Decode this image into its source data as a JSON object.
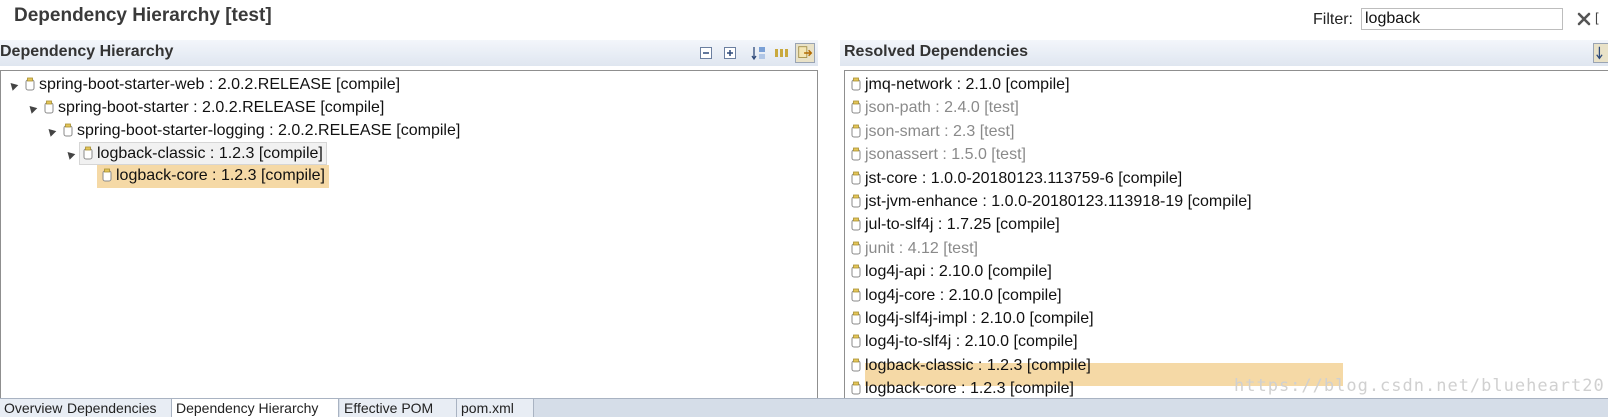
{
  "editor": {
    "title": "Dependency Hierarchy [test]",
    "filter_label": "Filter:",
    "filter_value": "logback"
  },
  "left_panel": {
    "title": "Dependency Hierarchy",
    "tools": [
      "collapse-all-icon",
      "expand-all-icon",
      "sort-alphabetically-icon",
      "show-groupid-icon",
      "link-with-selection-icon"
    ],
    "tree": [
      {
        "text": "spring-boot-starter-web : 2.0.2.RELEASE [compile]",
        "level": 0,
        "expanded": true
      },
      {
        "text": "spring-boot-starter : 2.0.2.RELEASE [compile]",
        "level": 1,
        "expanded": true
      },
      {
        "text": "spring-boot-starter-logging : 2.0.2.RELEASE [compile]",
        "level": 2,
        "expanded": true
      },
      {
        "text": "logback-classic : 1.2.3 [compile]",
        "level": 3,
        "expanded": true
      },
      {
        "text": "logback-core : 1.2.3 [compile]",
        "level": 4,
        "expanded": false
      }
    ]
  },
  "right_panel": {
    "title": "Resolved Dependencies",
    "items": [
      {
        "text": "jmq-network : 2.1.0 [compile]",
        "scope": "compile"
      },
      {
        "text": "json-path : 2.4.0 [test]",
        "scope": "test"
      },
      {
        "text": "json-smart : 2.3 [test]",
        "scope": "test"
      },
      {
        "text": "jsonassert : 1.5.0 [test]",
        "scope": "test"
      },
      {
        "text": "jst-core : 1.0.0-20180123.113759-6 [compile]",
        "scope": "compile"
      },
      {
        "text": "jst-jvm-enhance : 1.0.0-20180123.113918-19 [compile]",
        "scope": "compile"
      },
      {
        "text": "jul-to-slf4j : 1.7.25 [compile]",
        "scope": "compile"
      },
      {
        "text": "junit : 4.12 [test]",
        "scope": "test"
      },
      {
        "text": "log4j-api : 2.10.0 [compile]",
        "scope": "compile"
      },
      {
        "text": "log4j-core : 2.10.0 [compile]",
        "scope": "compile"
      },
      {
        "text": "log4j-slf4j-impl : 2.10.0 [compile]",
        "scope": "compile"
      },
      {
        "text": "log4j-to-slf4j : 2.10.0 [compile]",
        "scope": "compile"
      },
      {
        "text": "logback-classic : 1.2.3 [compile]",
        "scope": "compile"
      },
      {
        "text": "logback-core : 1.2.3 [compile]",
        "scope": "compile"
      }
    ]
  },
  "bottom_tabs": [
    "Overview",
    "Dependencies",
    "Dependency Hierarchy",
    "Effective POM",
    "pom.xml"
  ],
  "watermark": "https://blog.csdn.net/blueheart20",
  "colors": {
    "highlight": "#f5d9a6",
    "test_scope_text": "#8a8a8a",
    "header_gradient_top": "#f3f6fb",
    "header_gradient_bottom": "#dfe6f0"
  }
}
